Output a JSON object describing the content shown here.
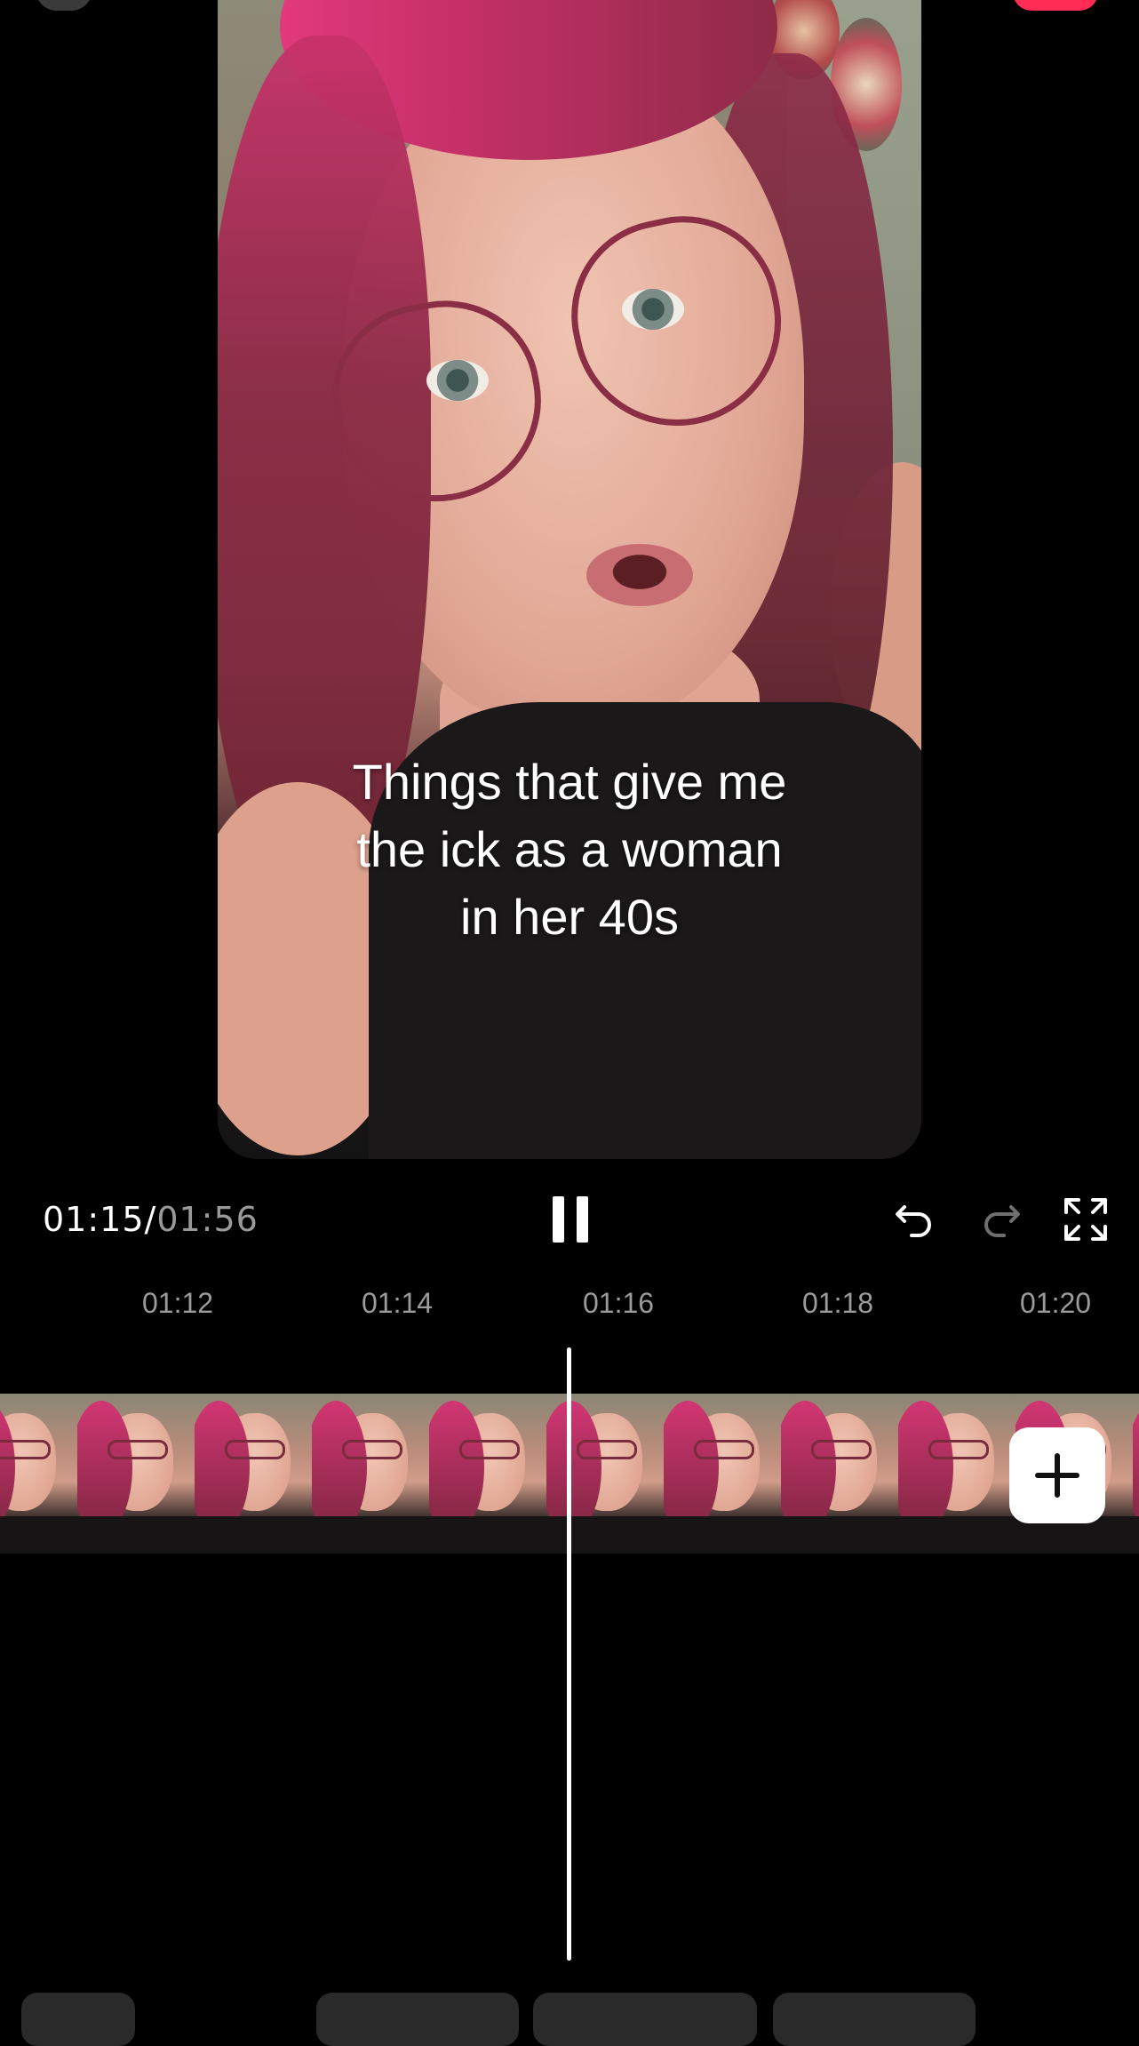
{
  "player": {
    "current_time": "01:15",
    "separator": "/",
    "total_time": "01:56"
  },
  "caption": {
    "line1": "Things that give me",
    "line2": "the ick as a woman",
    "line3": "in her 40s"
  },
  "timeline": {
    "ticks": [
      "01:12",
      "01:14",
      "01:16",
      "01:18",
      "01:20"
    ]
  },
  "icons": {
    "pause": "pause-icon",
    "undo": "undo-icon",
    "redo": "redo-icon",
    "fullscreen": "fullscreen-icon",
    "add": "plus-icon"
  },
  "colors": {
    "background": "#000000",
    "accent": "#ff2d55",
    "disabled": "#6f6f6f"
  }
}
